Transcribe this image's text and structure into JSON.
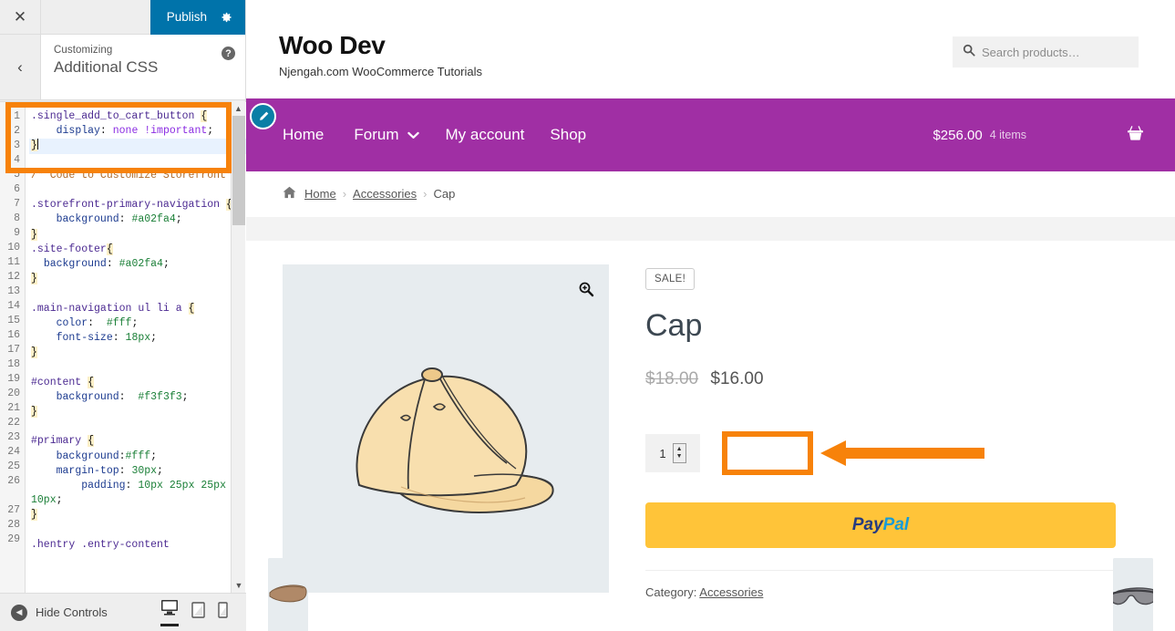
{
  "customizer": {
    "close_label": "✕",
    "publish_label": "Publish",
    "gear_icon": "gear-icon",
    "back_label": "‹",
    "help_label": "?",
    "breadcrumb_sup": "Customizing",
    "panel_title": "Additional CSS",
    "hide_controls_label": "Hide Controls",
    "devices": [
      {
        "name": "desktop",
        "label": "Desktop",
        "active": true
      },
      {
        "name": "tablet",
        "label": "Tablet",
        "active": false
      },
      {
        "name": "mobile",
        "label": "Mobile",
        "active": false
      }
    ],
    "editor": {
      "line_numbers": [
        "1",
        "2",
        "3",
        "4",
        "5",
        "6",
        "7",
        "8",
        "9",
        "10",
        "11",
        "12",
        "13",
        "14",
        "15",
        "16",
        "17",
        "18",
        "19",
        "20",
        "21",
        "22",
        "23",
        "24",
        "25",
        "26",
        "27",
        "28",
        "29"
      ],
      "lines": [
        {
          "n": 1,
          "text": ".single_add_to_cart_button {",
          "active": false
        },
        {
          "n": 2,
          "text": "    display: none !important;",
          "active": false
        },
        {
          "n": 3,
          "text": "}",
          "active": true
        },
        {
          "n": 4,
          "text": "",
          "active": false
        },
        {
          "n": 5,
          "text": "/* Code to Customize Storefront*/",
          "active": false
        },
        {
          "n": 6,
          "text": "",
          "active": false
        },
        {
          "n": 7,
          "text": ".storefront-primary-navigation {",
          "active": false
        },
        {
          "n": 8,
          "text": "    background: #a02fa4;",
          "active": false
        },
        {
          "n": 9,
          "text": "}",
          "active": false
        },
        {
          "n": 10,
          "text": ".site-footer{",
          "active": false
        },
        {
          "n": 11,
          "text": "  background: #a02fa4;",
          "active": false
        },
        {
          "n": 12,
          "text": "}",
          "active": false
        },
        {
          "n": 13,
          "text": "",
          "active": false
        },
        {
          "n": 14,
          "text": ".main-navigation ul li a {",
          "active": false
        },
        {
          "n": 15,
          "text": "    color:  #fff;",
          "active": false
        },
        {
          "n": 16,
          "text": "    font-size: 18px;",
          "active": false
        },
        {
          "n": 17,
          "text": "}",
          "active": false
        },
        {
          "n": 18,
          "text": "",
          "active": false
        },
        {
          "n": 19,
          "text": "#content {",
          "active": false
        },
        {
          "n": 20,
          "text": "    background:  #f3f3f3;",
          "active": false
        },
        {
          "n": 21,
          "text": "}",
          "active": false
        },
        {
          "n": 22,
          "text": "",
          "active": false
        },
        {
          "n": 23,
          "text": "#primary {",
          "active": false
        },
        {
          "n": 24,
          "text": "    background:#fff;",
          "active": false
        },
        {
          "n": 25,
          "text": "    margin-top: 30px;",
          "active": false
        },
        {
          "n": 26,
          "text": "        padding: 10px 25px 25px 10px;",
          "active": false
        },
        {
          "n": 27,
          "text": "}",
          "active": false
        },
        {
          "n": 28,
          "text": "",
          "active": false
        },
        {
          "n": 29,
          "text": ".hentry .entry-content",
          "active": false
        }
      ],
      "scroll_up": "▲",
      "scroll_down": "▼"
    }
  },
  "site": {
    "title": "Woo Dev",
    "tagline": "Njengah.com WooCommerce Tutorials",
    "search_placeholder": "Search products…",
    "search_icon": "search-icon",
    "edit_icon": "pencil-icon",
    "nav": [
      {
        "label": "Home",
        "has_dropdown": false
      },
      {
        "label": "Forum",
        "has_dropdown": true
      },
      {
        "label": "My account",
        "has_dropdown": false
      },
      {
        "label": "Shop",
        "has_dropdown": false
      }
    ],
    "cart": {
      "amount": "$256.00",
      "items": "4 items",
      "icon": "basket-icon"
    },
    "breadcrumb": {
      "home_icon": "home-icon",
      "items": [
        {
          "label": "Home",
          "link": true
        },
        {
          "label": "Accessories",
          "link": true
        },
        {
          "label": "Cap",
          "link": false
        }
      ],
      "separator": "›"
    }
  },
  "product": {
    "sale_badge": "SALE!",
    "name": "Cap",
    "old_price": "$18.00",
    "new_price": "$16.00",
    "quantity": "1",
    "qty_up": "▲",
    "qty_down": "▼",
    "paypal_part1": "Pay",
    "paypal_part2": "Pal",
    "category_label": "Category:",
    "category_value": "Accessories",
    "zoom_icon": "zoom-in-icon",
    "image_alt": "cap-product-image"
  },
  "annotations": {
    "highlight_color": "#f7820a",
    "arrow_name": "orange-arrow-annotation",
    "editor_box_name": "css-snippet-highlight"
  },
  "colors": {
    "nav_purple": "#a02fa4",
    "publish_blue": "#0073aa",
    "paypal_yellow": "#ffc439",
    "content_grey": "#f3f3f3"
  }
}
